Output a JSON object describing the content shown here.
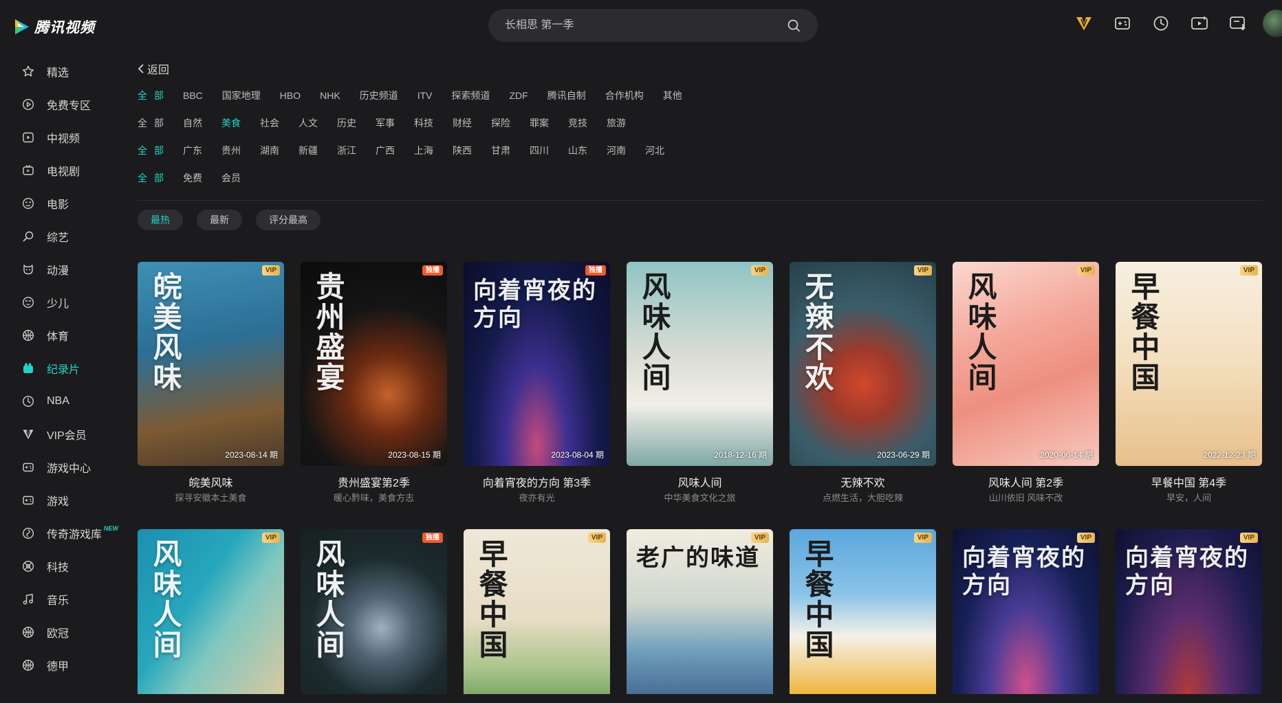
{
  "app": {
    "logo_text": "腾讯视频",
    "search_placeholder": "长相思 第一季"
  },
  "top_icons": [
    "vip-icon",
    "game-icon",
    "history-icon",
    "upload-icon",
    "download-icon"
  ],
  "sidebar": {
    "items": [
      {
        "label": "精选",
        "icon": "star-icon"
      },
      {
        "label": "免费专区",
        "icon": "play-circle-icon"
      },
      {
        "label": "中视频",
        "icon": "video-icon"
      },
      {
        "label": "电视剧",
        "icon": "tv-icon"
      },
      {
        "label": "电影",
        "icon": "film-icon"
      },
      {
        "label": "综艺",
        "icon": "mic-icon"
      },
      {
        "label": "动漫",
        "icon": "anime-icon"
      },
      {
        "label": "少儿",
        "icon": "kids-icon"
      },
      {
        "label": "体育",
        "icon": "ball-icon"
      },
      {
        "label": "纪录片",
        "icon": "documentary-icon",
        "active": true
      },
      {
        "label": "NBA",
        "icon": "nba-icon"
      },
      {
        "label": "VIP会员",
        "icon": "vip-icon"
      },
      {
        "label": "游戏中心",
        "icon": "gamepad-icon"
      },
      {
        "label": "游戏",
        "icon": "gamepad-icon"
      },
      {
        "label": "传奇游戏库",
        "icon": "legend-icon",
        "badge": "NEW"
      },
      {
        "label": "科技",
        "icon": "tech-icon"
      },
      {
        "label": "音乐",
        "icon": "music-icon"
      },
      {
        "label": "欧冠",
        "icon": "ball-icon"
      },
      {
        "label": "德甲",
        "icon": "ball-icon"
      }
    ]
  },
  "back_label": "返回",
  "filters": [
    {
      "options": [
        "全部",
        "BBC",
        "国家地理",
        "HBO",
        "NHK",
        "历史频道",
        "ITV",
        "探索频道",
        "ZDF",
        "腾讯自制",
        "合作机构",
        "其他"
      ],
      "selected": 0
    },
    {
      "options": [
        "全部",
        "自然",
        "美食",
        "社会",
        "人文",
        "历史",
        "军事",
        "科技",
        "财经",
        "探险",
        "罪案",
        "竞技",
        "旅游"
      ],
      "selected": 2
    },
    {
      "options": [
        "全部",
        "广东",
        "贵州",
        "湖南",
        "新疆",
        "浙江",
        "广西",
        "上海",
        "陕西",
        "甘肃",
        "四川",
        "山东",
        "河南",
        "河北"
      ],
      "selected": 0
    },
    {
      "options": [
        "全部",
        "免费",
        "会员"
      ],
      "selected": 0
    }
  ],
  "sorts": {
    "options": [
      "最热",
      "最新",
      "评分最高"
    ],
    "selected": 0
  },
  "cards_row1": [
    {
      "title": "皖美风味",
      "sub": "探寻安徽本土美食",
      "date": "2023-08-14 期",
      "badge": "VIP",
      "badge_type": "vip",
      "poster_text": "皖美风味",
      "bg": "linear-gradient(170deg,#3f8fb5 0%,#2c6f95 40%,#7c5a33 75%,#4a3a2a 100%)",
      "dark_text": false
    },
    {
      "title": "贵州盛宴第2季",
      "sub": "暖心黔味，美食方志",
      "date": "2023-08-15 期",
      "badge": "独播",
      "badge_type": "excl",
      "poster_text": "贵州盛宴",
      "bg": "radial-gradient(circle at 60% 65%,#c5622a 0%,#6b2a12 25%,#151515 55%,#0b0b0b 100%)",
      "dark_text": false
    },
    {
      "title": "向着宵夜的方向 第3季",
      "sub": "夜亦有光",
      "date": "2023-08-04 期",
      "badge": "独播",
      "badge_type": "excl",
      "poster_text": "向着宵夜的方向",
      "bg": "radial-gradient(ellipse at 50% 90%,#c44a7a 0%,#3c2f8f 30%,#141a4a 60%,#0b0d2a 100%)",
      "dark_text": false
    },
    {
      "title": "风味人间",
      "sub": "中华美食文化之旅",
      "date": "2018-12-16 期",
      "badge": "VIP",
      "badge_type": "vip",
      "poster_text": "风味人间",
      "bg": "linear-gradient(180deg,#8fc4c4 0%,#d9dcd4 45%,#f1eee7 70%,#7fa8a6 100%)",
      "dark_text": true
    },
    {
      "title": "无辣不欢",
      "sub": "点燃生活，大胆吃辣",
      "date": "2023-06-29 期",
      "badge": "VIP",
      "badge_type": "vip",
      "poster_text": "无辣不欢",
      "bg": "radial-gradient(circle at 50% 60%,#d2472c 0%,#9b3a2c 25%,#3b5d6a 55%,#25414b 100%)",
      "dark_text": false
    },
    {
      "title": "风味人间 第2季",
      "sub": "山川依旧 风味不改",
      "date": "2020-06-14 期",
      "badge": "VIP",
      "badge_type": "vip",
      "poster_text": "风味人间",
      "bg": "linear-gradient(160deg,#fbd8d0 0%,#f4a89a 35%,#ee8f80 60%,#f7c9bd 100%)",
      "dark_text": true
    },
    {
      "title": "早餐中国 第4季",
      "sub": "早安，人间",
      "date": "2022-12-23 期",
      "badge": "VIP",
      "badge_type": "vip",
      "poster_text": "早餐中国",
      "bg": "linear-gradient(180deg,#f7efe1 0%,#f3dfbd 50%,#e8c08c 100%)",
      "dark_text": true
    }
  ],
  "cards_row2": [
    {
      "badge": "VIP",
      "badge_type": "vip",
      "poster_text": "风味人间",
      "bg": "linear-gradient(125deg,#1c8fb0 0%,#27a7bd 40%,#7fc7c0 60%,#d9c9a0 100%)",
      "dark_text": false
    },
    {
      "badge": "独播",
      "badge_type": "excl",
      "poster_text": "风味人间",
      "bg": "radial-gradient(circle at 55% 60%,#9fb1c1 0%,#4f6373 25%,#1d2b2e 55%,#16201f 100%)",
      "dark_text": false
    },
    {
      "badge": "VIP",
      "badge_type": "vip",
      "poster_text": "早餐中国",
      "bg": "linear-gradient(180deg,#efe8d8 0%,#e7dcc4 55%,#a9c48a 85%,#7fa86b 100%)",
      "dark_text": true
    },
    {
      "badge": "VIP",
      "badge_type": "vip",
      "poster_text": "老广的味道",
      "bg": "linear-gradient(180deg,#f1ece0 0%,#cfd7cd 45%,#6d9dbb 75%,#4a6f93 100%)",
      "dark_text": true
    },
    {
      "badge": "VIP",
      "badge_type": "vip",
      "poster_text": "早餐中国",
      "bg": "linear-gradient(180deg,#5aa7dd 0%,#8cc4e8 40%,#f4f1e8 65%,#f0b640 100%)",
      "dark_text": true
    },
    {
      "badge": "VIP",
      "badge_type": "vip",
      "poster_text": "向着宵夜的方向",
      "bg": "radial-gradient(ellipse at 50% 95%,#d0508b 0%,#4a3c95 35%,#172056 65%,#0d1233 100%)",
      "dark_text": false
    },
    {
      "badge": "VIP",
      "badge_type": "vip",
      "poster_text": "向着宵夜的方向",
      "bg": "radial-gradient(ellipse at 50% 100%,#b23a3a 0%,#5b2c6d 35%,#1d1d4d 70%,#101032 100%)",
      "dark_text": false
    }
  ],
  "colors": {
    "accent": "#22d3c5",
    "bg": "#1b1b1d",
    "vip": "#e8b44d",
    "exclusive": "#f05a28"
  }
}
